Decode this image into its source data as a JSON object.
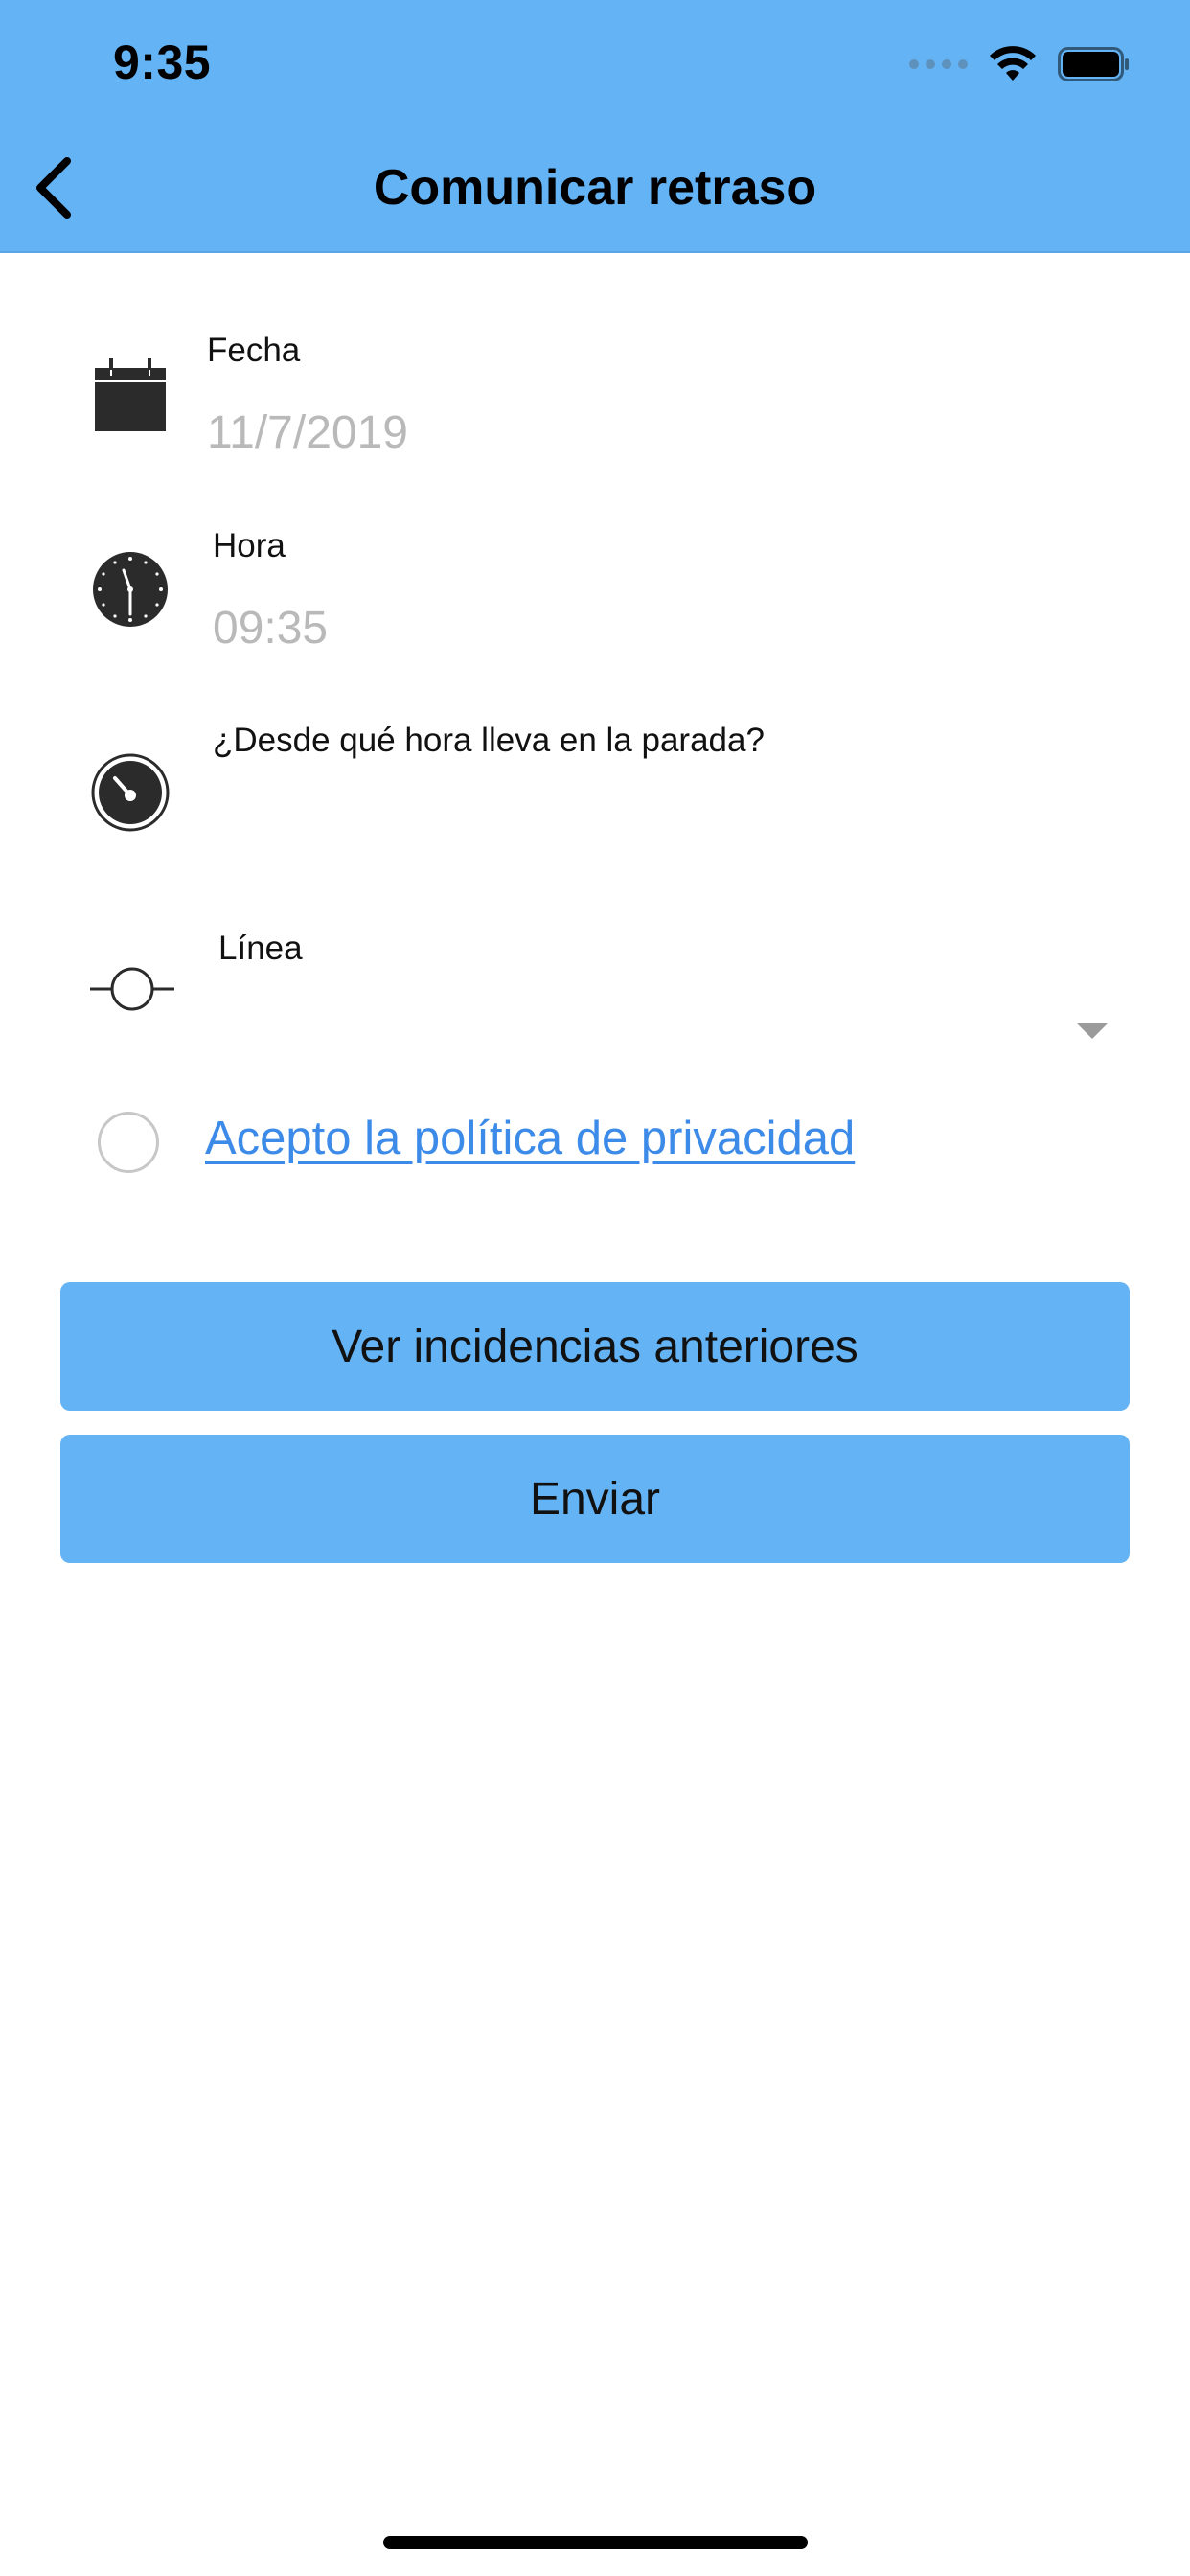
{
  "status_bar": {
    "time": "9:35"
  },
  "header": {
    "title": "Comunicar retraso",
    "background": "#63b3f5"
  },
  "form": {
    "fecha": {
      "label": "Fecha",
      "value": "11/7/2019",
      "icon": "calendar-icon"
    },
    "hora": {
      "label": "Hora",
      "value": "09:35",
      "icon": "clock-icon"
    },
    "desde": {
      "label": "¿Desde qué hora lleva en la parada?",
      "value": "",
      "icon": "timer-icon"
    },
    "linea": {
      "label": "Línea",
      "value": "",
      "icon": "line-stop-icon"
    }
  },
  "privacy": {
    "link_text": "Acepto la política de privacidad",
    "accepted": false,
    "link_color": "#3d8be8"
  },
  "buttons": {
    "previous_incidents": "Ver incidencias anteriores",
    "send": "Enviar"
  }
}
